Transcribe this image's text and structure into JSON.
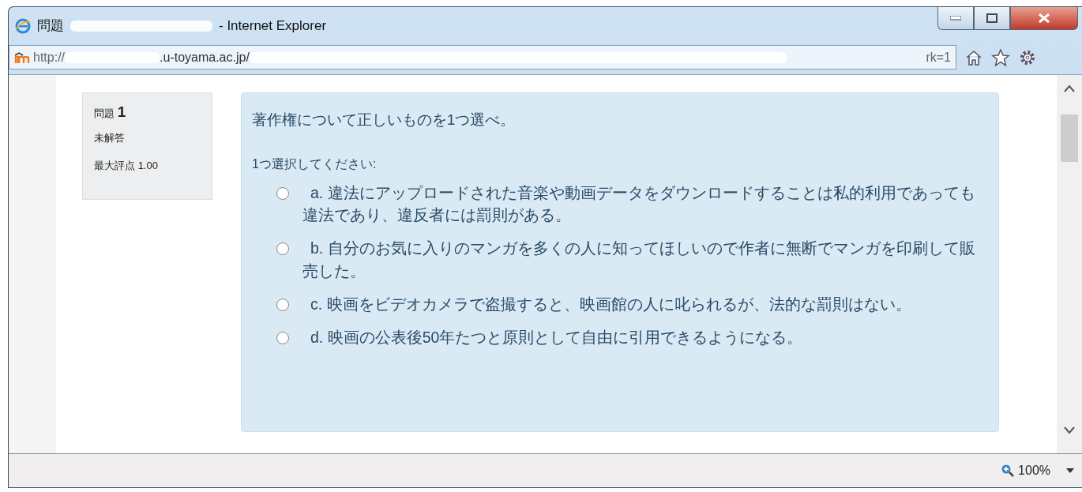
{
  "window": {
    "title_prefix": "問題",
    "title_suffix": "- Internet Explorer"
  },
  "address": {
    "scheme": "http://",
    "host": ".u-toyama.ac.jp/",
    "tail": "rk=1"
  },
  "question_info": {
    "label": "問題",
    "number": "1",
    "status": "未解答",
    "max_grade_label": "最大評点",
    "max_grade": "1.00"
  },
  "question": {
    "text": "著作権について正しいものを1つ選べ。",
    "prompt": "1つ選択してください:",
    "options": [
      {
        "text": "a. 違法にアップロードされた音楽や動画データをダウンロードすることは私的利用であっても違法であり、違反者には罰則がある。",
        "selected": false
      },
      {
        "text": "b. 自分のお気に入りのマンガを多くの人に知ってほしいので作者に無断でマンガを印刷して販売した。",
        "selected": false
      },
      {
        "text": "c. 映画をビデオカメラで盗撮すると、映画館の人に叱られるが、法的な罰則はない。",
        "selected": false
      },
      {
        "text": "d. 映画の公表後50年たつと原則として自由に引用できるようになる。",
        "selected": false
      }
    ]
  },
  "status_bar": {
    "zoom": "100%"
  }
}
